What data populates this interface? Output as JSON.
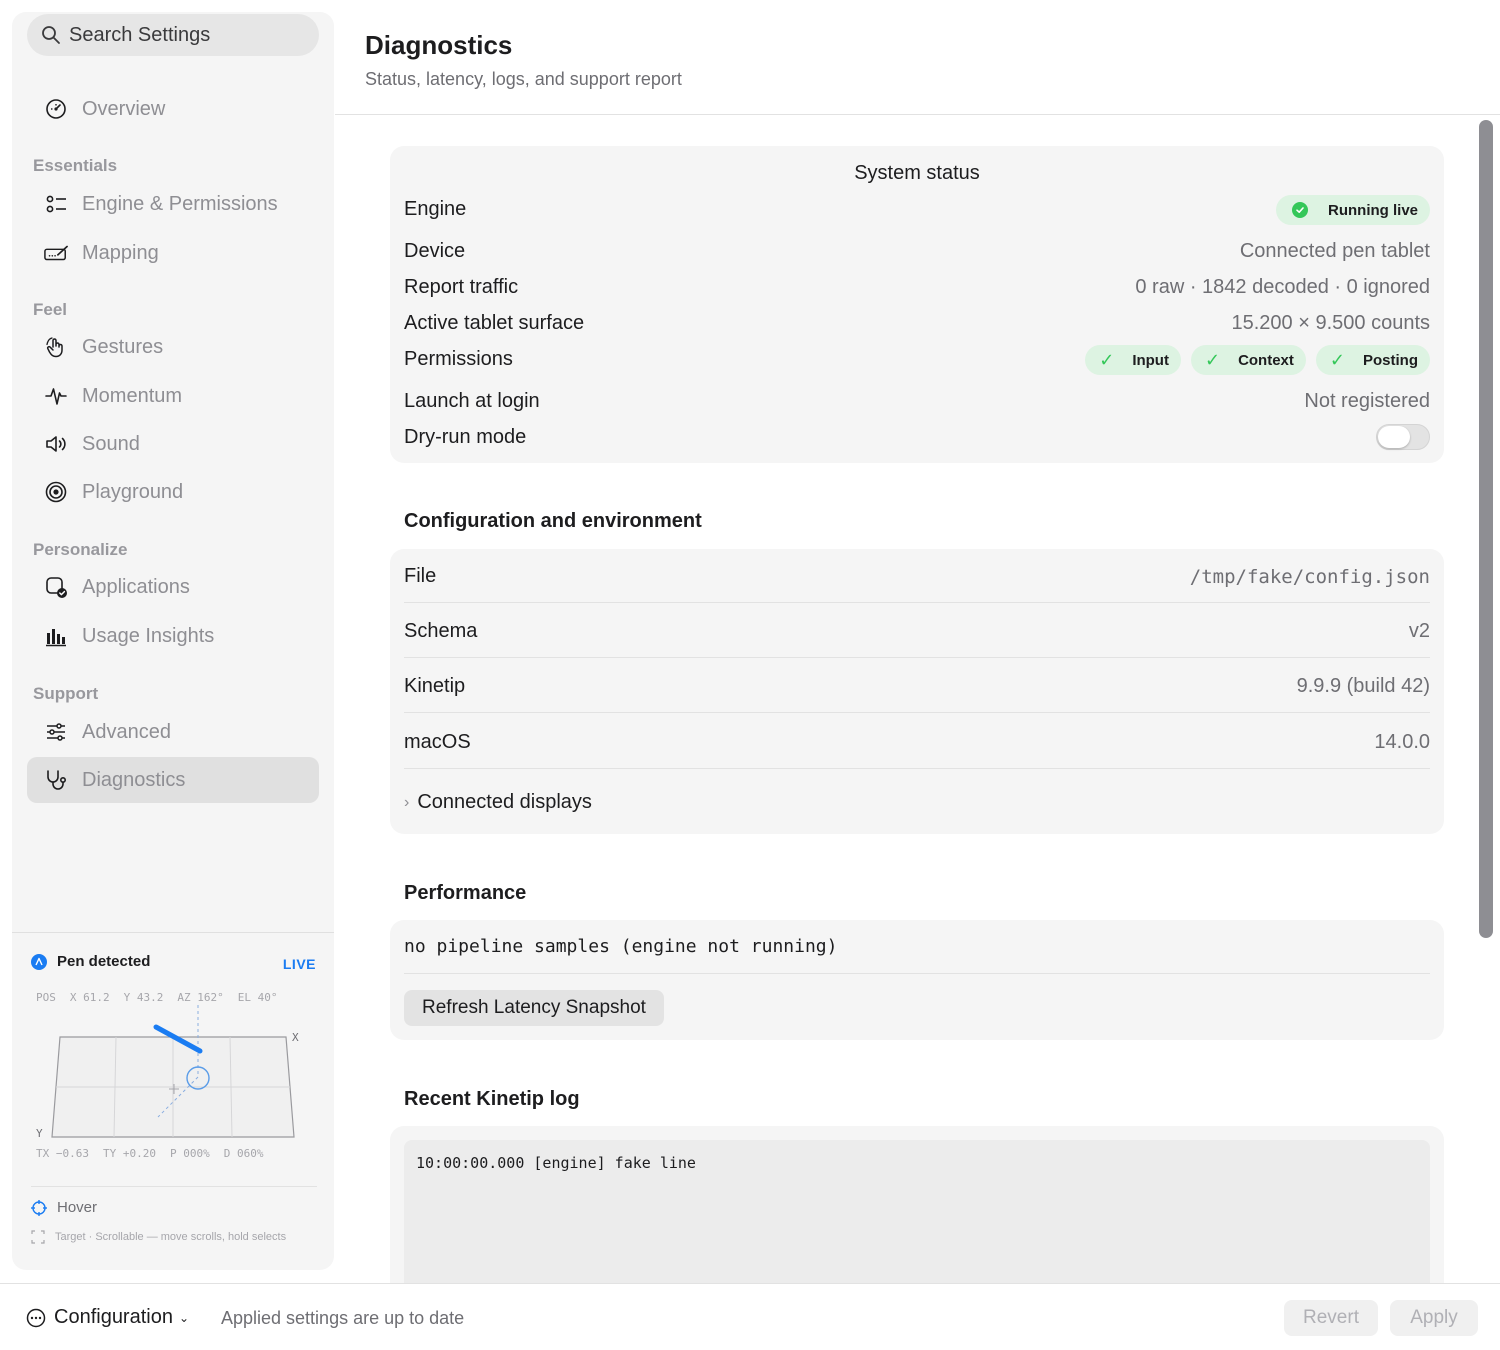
{
  "sidebar": {
    "search_placeholder": "Search Settings",
    "overview": "Overview",
    "sections": {
      "essentials": "Essentials",
      "feel": "Feel",
      "personalize": "Personalize",
      "support": "Support"
    },
    "items": {
      "engine_permissions": "Engine & Permissions",
      "mapping": "Mapping",
      "gestures": "Gestures",
      "momentum": "Momentum",
      "sound": "Sound",
      "playground": "Playground",
      "applications": "Applications",
      "usage_insights": "Usage Insights",
      "advanced": "Advanced",
      "diagnostics": "Diagnostics"
    },
    "active_item": "Diagnostics",
    "pen": {
      "title": "Pen detected",
      "live": "LIVE",
      "pos": "POS",
      "x": "X 61.2",
      "y": "Y 43.2",
      "az": "AZ 162°",
      "el": "EL 40°",
      "tx": "TX −0.63",
      "ty": "TY +0.20",
      "p": "P 000%",
      "d": "D 060%",
      "axis_x": "X",
      "axis_y": "Y",
      "hover": "Hover",
      "target": "Target · Scrollable — move scrolls, hold selects"
    }
  },
  "header": {
    "title": "Diagnostics",
    "subtitle": "Status, latency, logs, and support report"
  },
  "system_status": {
    "title": "System status",
    "engine_label": "Engine",
    "engine_value": "Running live",
    "device_label": "Device",
    "device_value": "Connected pen tablet",
    "traffic_label": "Report traffic",
    "traffic_value": "0 raw · 1842 decoded · 0 ignored",
    "surface_label": "Active tablet surface",
    "surface_value": "15.200 × 9.500 counts",
    "permissions_label": "Permissions",
    "permissions": [
      "Input",
      "Context",
      "Posting"
    ],
    "launch_label": "Launch at login",
    "launch_value": "Not registered",
    "dryrun_label": "Dry-run mode",
    "dryrun_on": false
  },
  "config_env": {
    "heading": "Configuration and environment",
    "file_label": "File",
    "file_value": "/tmp/fake/config.json",
    "schema_label": "Schema",
    "schema_value": "v2",
    "kinetip_label": "Kinetip",
    "kinetip_value": "9.9.9 (build 42)",
    "macos_label": "macOS",
    "macos_value": "14.0.0",
    "displays_label": "Connected displays"
  },
  "performance": {
    "heading": "Performance",
    "text": "no pipeline samples (engine not running)",
    "refresh_label": "Refresh Latency Snapshot"
  },
  "log": {
    "heading": "Recent Kinetip log",
    "lines": [
      "10:00:00.000 [engine] fake line"
    ]
  },
  "footer": {
    "config_label": "Configuration",
    "status": "Applied settings are up to date",
    "revert": "Revert",
    "apply": "Apply"
  },
  "colors": {
    "accent": "#1a7cf2",
    "success": "#34c759",
    "pill_bg": "#ddf3e2"
  }
}
